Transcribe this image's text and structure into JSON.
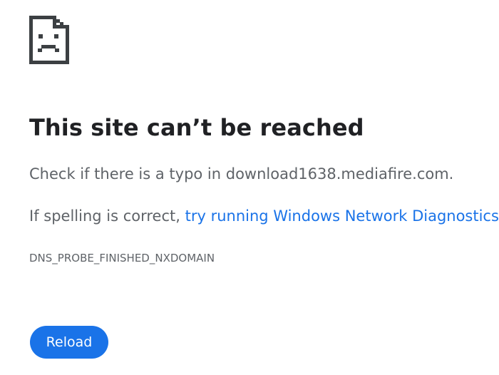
{
  "icon": "sad-page-icon",
  "title": "This site can’t be reached",
  "typo_prefix": "Check if there is a typo in ",
  "domain": "download1638.mediafire.com",
  "typo_suffix": ".",
  "spelling_prefix": "If spelling is correct, ",
  "diagnostics_link": "try running Windows Network Diagnostics",
  "spelling_suffix": ".",
  "error_code": "DNS_PROBE_FINISHED_NXDOMAIN",
  "reload_label": "Reload",
  "colors": {
    "accent": "#1a73e8",
    "title_text": "#202124",
    "body_text": "#5f6368",
    "icon": "#3c4043"
  }
}
